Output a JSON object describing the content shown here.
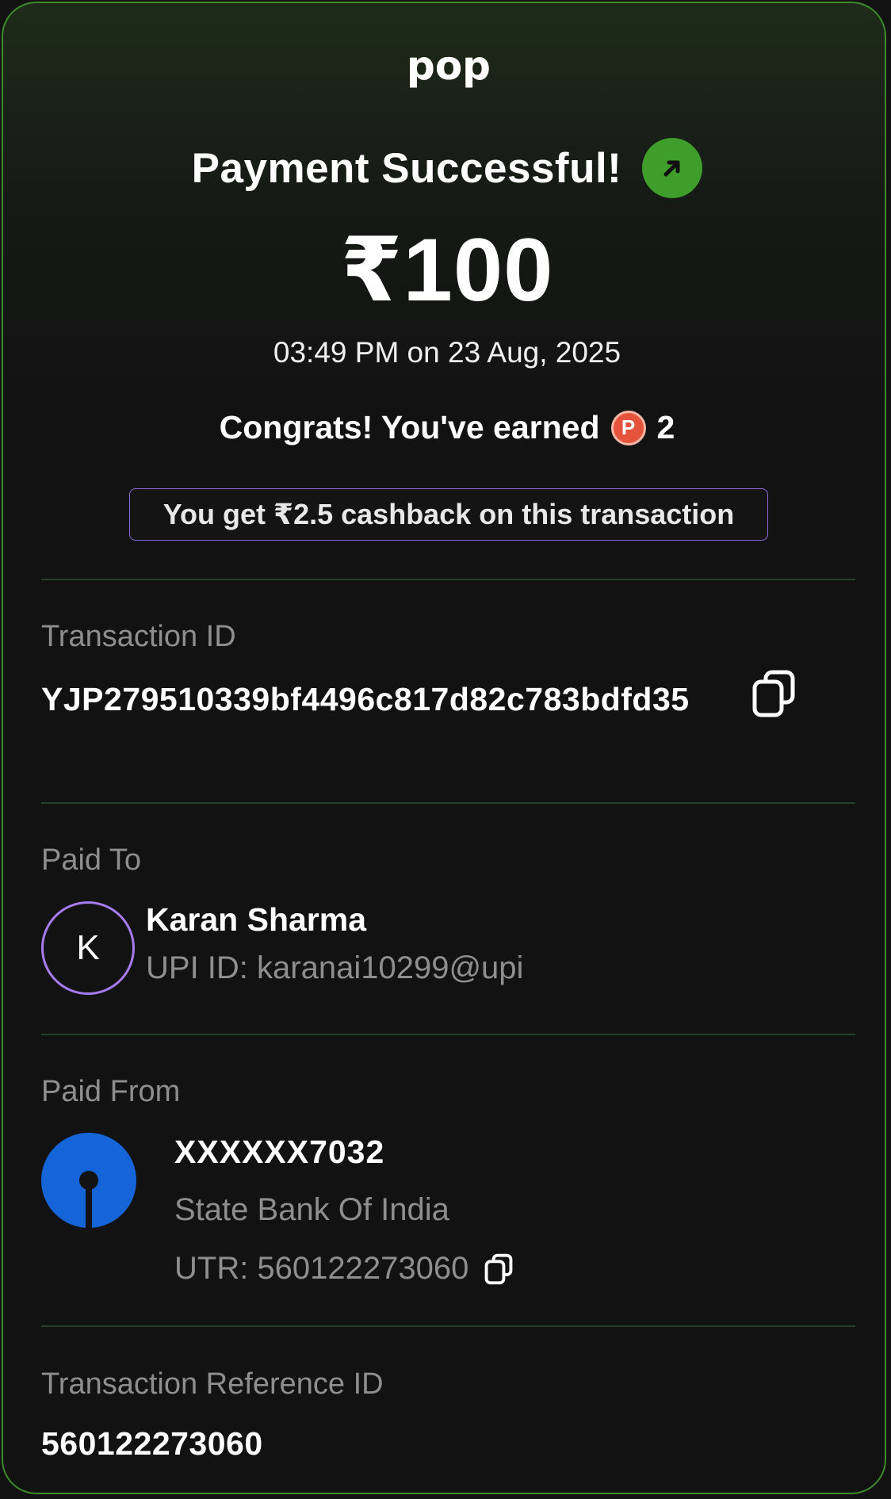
{
  "app": {
    "logo_text": "pop"
  },
  "header": {
    "title": "Payment Successful!",
    "amount": "₹100",
    "datetime": "03:49 PM on 23 Aug, 2025",
    "congrats_prefix": "Congrats! You've earned",
    "coin_symbol": "P",
    "coins_earned": "2",
    "cashback_text": "You get ₹2.5 cashback on this transaction"
  },
  "transaction": {
    "label": "Transaction ID",
    "value": "YJP279510339bf4496c817d82c783bdfd35"
  },
  "paid_to": {
    "label": "Paid To",
    "avatar_initial": "K",
    "name": "Karan Sharma",
    "upi": "UPI ID: karanai10299@upi"
  },
  "paid_from": {
    "label": "Paid From",
    "account": "XXXXXX7032",
    "bank": "State Bank Of India",
    "utr": "UTR: 560122273060"
  },
  "reference": {
    "label": "Transaction Reference ID",
    "value": "560122273060"
  },
  "colors": {
    "success_green": "#3f9d2a",
    "border_green": "#3e8a2c",
    "cashback_border": "#8c6ad6",
    "avatar_border": "#a57cf0",
    "sbi_blue": "#1565d8",
    "pop_red": "#e5533d"
  }
}
